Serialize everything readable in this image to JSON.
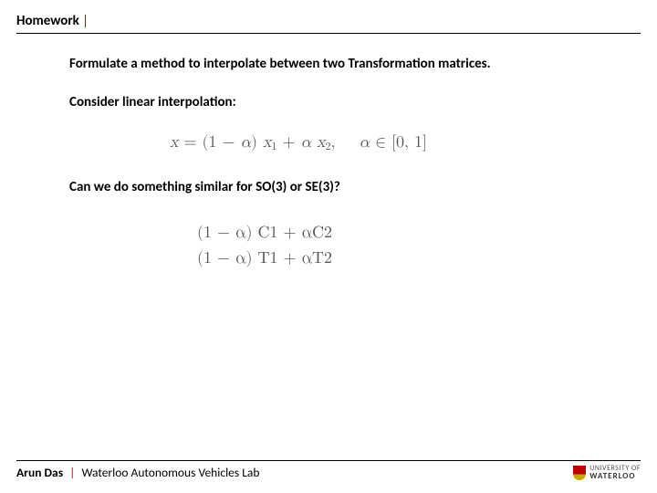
{
  "header": {
    "title": "Homework"
  },
  "content": {
    "p1": "Formulate a method to interpolate between two Transformation matrices.",
    "p2": "Consider linear interpolation:",
    "p3": "Can we do something similar for SO(3) or SE(3)?"
  },
  "equations": {
    "lerp_lhs": "x",
    "lerp_eq": " = (1 − ",
    "alpha": "α",
    "lerp_mid1": ") ",
    "x1": "x",
    "sub1": "1",
    "lerp_plus": " + ",
    "lerp_mid2": " ",
    "x2": "x",
    "sub2": "2",
    "lerp_comma": ",",
    "alpha_range_pre": " ∈ [0, 1]",
    "row1_open": "(1 − ",
    "row1_close": ") ",
    "C1": "C",
    "C2": "C",
    "row2_open": "(1 − ",
    "row2_close": ") ",
    "T1": "T",
    "T2": "T"
  },
  "footer": {
    "author": "Arun Das",
    "lab": "Waterloo Autonomous Vehicles Lab",
    "logo_top": "UNIVERSITY OF",
    "logo_bottom": "WATERLOO"
  }
}
